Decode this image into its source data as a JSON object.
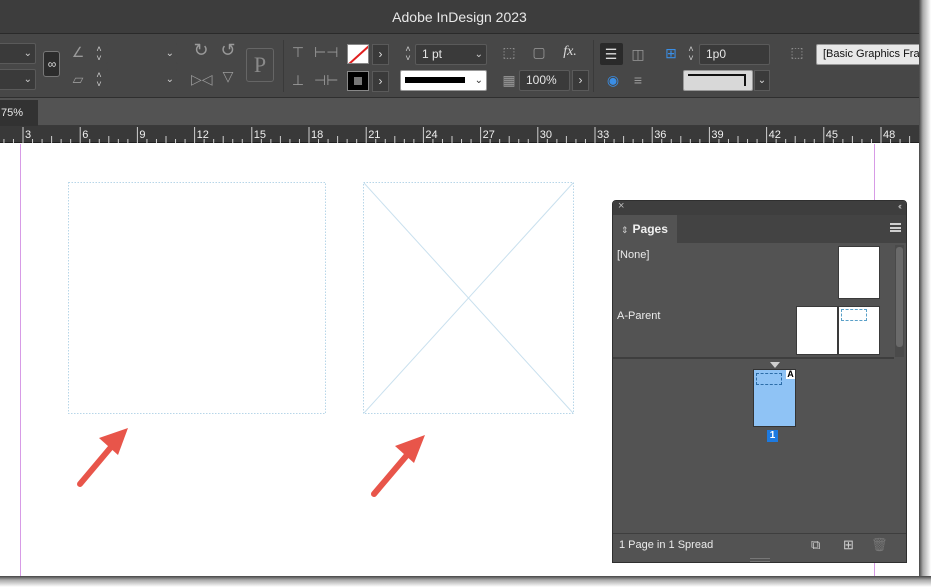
{
  "window": {
    "title": "Adobe InDesign 2023"
  },
  "control_bar": {
    "stroke_weight": "1 pt",
    "opacity": "100%",
    "spacing_value": "1p0",
    "object_style": "[Basic Graphics Frame]",
    "reference_point_letter": "P",
    "effects_label": "fx."
  },
  "document": {
    "zoom": "75%"
  },
  "ruler": {
    "labels": [
      "3",
      "6",
      "9",
      "12",
      "15",
      "18",
      "21",
      "24",
      "27",
      "30",
      "33",
      "36",
      "39",
      "42",
      "45",
      "48"
    ]
  },
  "pages_panel": {
    "tab_label": "Pages",
    "parents": [
      {
        "label": "[None]"
      },
      {
        "label": "A-Parent"
      }
    ],
    "page": {
      "number": "1",
      "prefix": "A"
    },
    "status": "1 Page in 1 Spread"
  },
  "colors": {
    "frame_edge": "#b7d6e8",
    "arrow": "#e8554a",
    "guide": "#d79be6",
    "page_thumb_selected": "#8fc3f5"
  },
  "icons": [
    "constrain-proportions-icon",
    "rotate-cw-icon",
    "rotate-ccw-icon",
    "flip-horizontal-icon",
    "flip-vertical-icon",
    "fill-swatch-icon",
    "stroke-swatch-icon",
    "fx-icon",
    "align-icon",
    "new-page-icon",
    "delete-page-icon",
    "edit-page-size-icon",
    "panel-menu-icon",
    "close-icon"
  ]
}
